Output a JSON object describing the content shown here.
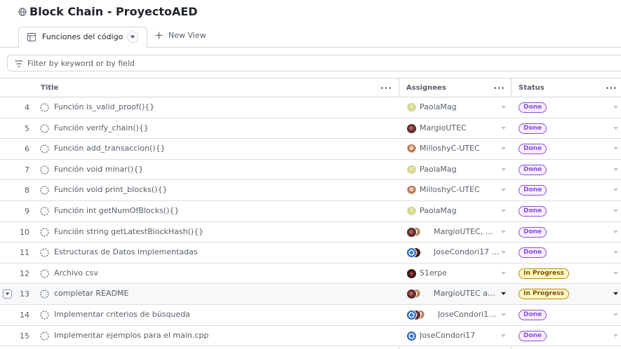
{
  "project": {
    "title": "Block Chain - ProyectoAED"
  },
  "views": {
    "active_tab": "Funciones del código",
    "new_view_label": "New View"
  },
  "filter": {
    "placeholder": "Filter by keyword or by field"
  },
  "columns": {
    "title": "Title",
    "assignees": "Assignees",
    "status": "Status"
  },
  "colors": {
    "done_border": "#8250df",
    "done_bg": "#fbefff",
    "progress_border": "#bf8700",
    "progress_bg": "#fff8c5"
  },
  "rows": [
    {
      "num": "4",
      "title": "Función is_valid_proof(){}",
      "assignees": "PaolaMag",
      "avatars": [
        "paola"
      ],
      "status": "Done"
    },
    {
      "num": "5",
      "title": "Función verify_chain(){}",
      "assignees": "MargioUTEC",
      "avatars": [
        "margio"
      ],
      "status": "Done"
    },
    {
      "num": "6",
      "title": "Función add_transaccion(){}",
      "assignees": "MilloshyC-UTEC",
      "avatars": [
        "milloshy"
      ],
      "status": "Done"
    },
    {
      "num": "7",
      "title": "Función void minar(){}",
      "assignees": "PaolaMag",
      "avatars": [
        "paola"
      ],
      "status": "Done"
    },
    {
      "num": "8",
      "title": "Función void print_blocks(){}",
      "assignees": "MilloshyC-UTEC",
      "avatars": [
        "milloshy"
      ],
      "status": "Done"
    },
    {
      "num": "9",
      "title": "Función int getNumOfBlocks(){}",
      "assignees": "PaolaMag",
      "avatars": [
        "paola"
      ],
      "status": "Done"
    },
    {
      "num": "10",
      "title": "Función string getLatestBlockHash(){}",
      "assignees": "MargioUTEC, Mill...",
      "avatars": [
        "margio",
        "milloshy"
      ],
      "status": "Done"
    },
    {
      "num": "11",
      "title": "Estructuras de Datos implementadas",
      "assignees": "JoseCondori17 an...",
      "avatars": [
        "jose",
        "s1erpe"
      ],
      "status": "Done"
    },
    {
      "num": "12",
      "title": "Archivo csv",
      "assignees": "S1erpe",
      "avatars": [
        "s1erpe"
      ],
      "status": "In Progress"
    },
    {
      "num": "13",
      "title": "completar README",
      "assignees": "MargioUTEC and ...",
      "avatars": [
        "margio",
        "milloshy"
      ],
      "status": "In Progress",
      "hovered": true
    },
    {
      "num": "14",
      "title": "Implementar criterios de búsqueda",
      "assignees": "JoseCondori17, ...",
      "avatars": [
        "jose",
        "margio",
        "milloshy"
      ],
      "status": "Done"
    },
    {
      "num": "15",
      "title": "Implementar ejemplos para el main.cpp",
      "assignees": "JoseCondori17",
      "avatars": [
        "jose"
      ],
      "status": "Done"
    }
  ]
}
